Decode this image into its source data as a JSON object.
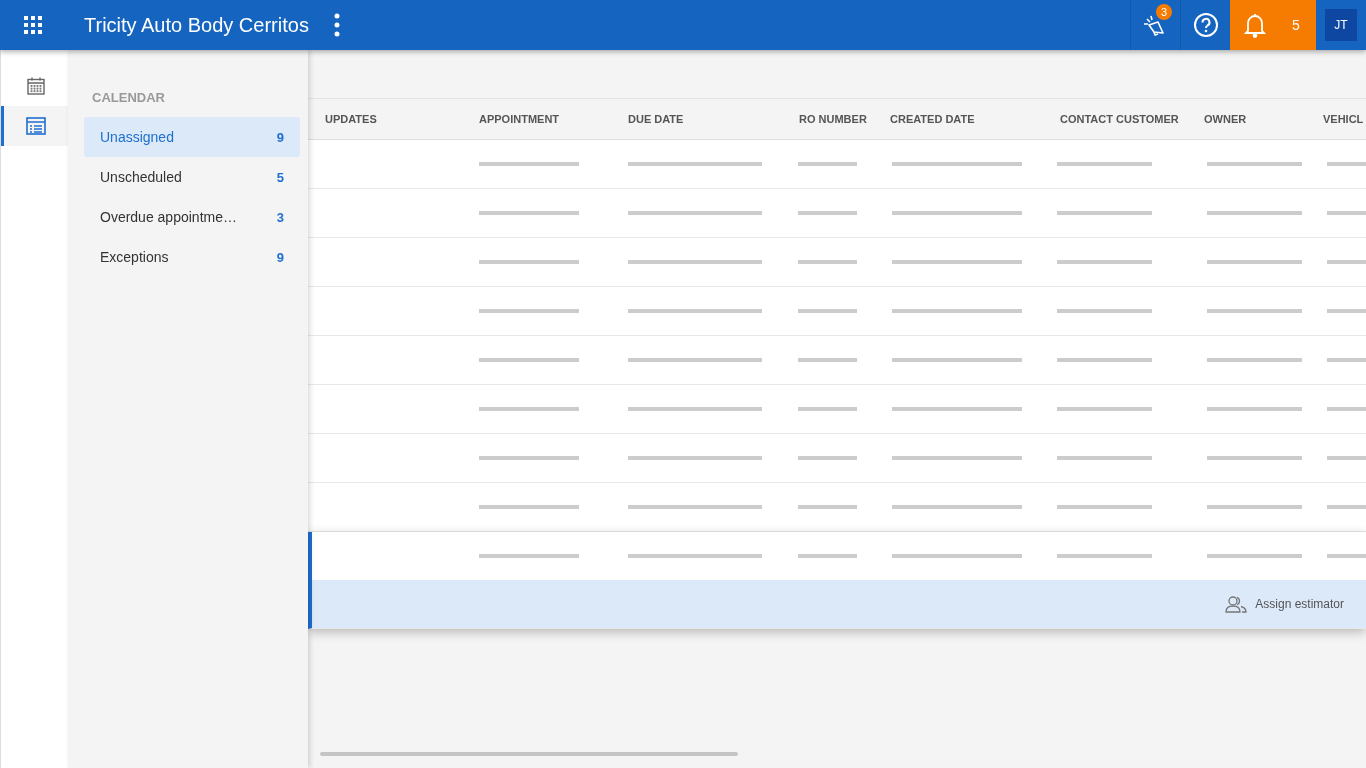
{
  "app_bar": {
    "title": "Tricity Auto Body Cerritos",
    "announcements_badge": "3",
    "notifications_count": "5",
    "user_initials": "JT"
  },
  "rail": [
    {
      "kind": "calendar",
      "selected": false
    },
    {
      "kind": "list",
      "selected": true
    }
  ],
  "sidebar": {
    "heading": "CALENDAR",
    "items": [
      {
        "label": "Unassigned",
        "count": "9",
        "selected": true
      },
      {
        "label": "Unscheduled",
        "count": "5",
        "selected": false
      },
      {
        "label": "Overdue appointme…",
        "count": "3",
        "selected": false
      },
      {
        "label": "Exceptions",
        "count": "9",
        "selected": false
      }
    ]
  },
  "table": {
    "columns": [
      "UPDATES",
      "APPOINTMENT",
      "DUE DATE",
      "RO NUMBER",
      "CREATED DATE",
      "CONTACT CUSTOMER",
      "OWNER",
      "VEHICL"
    ],
    "rows": [
      {
        "selected": false
      },
      {
        "selected": false
      },
      {
        "selected": false
      },
      {
        "selected": false
      },
      {
        "selected": false
      },
      {
        "selected": false
      },
      {
        "selected": false
      },
      {
        "selected": false
      },
      {
        "selected": true
      }
    ],
    "row_action": "Assign estimator"
  }
}
